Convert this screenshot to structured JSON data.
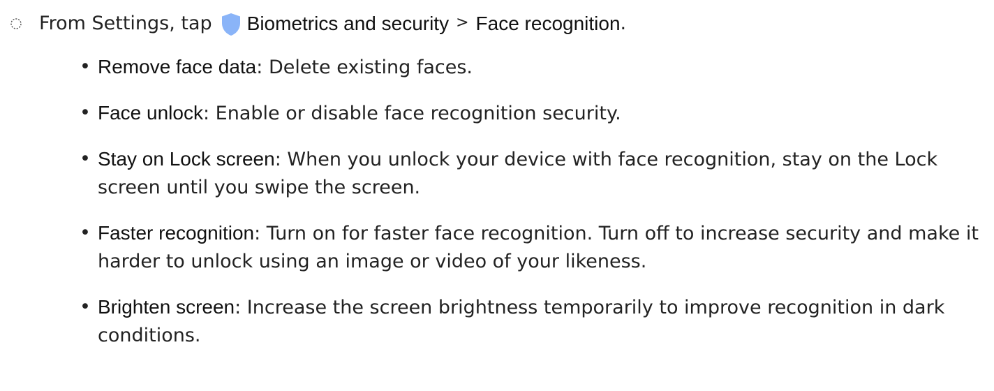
{
  "intro": {
    "prefix": "From Settings, tap",
    "icon": "shield-icon",
    "icon_color": "#8ab4f8",
    "menu_item": "Biometrics and security",
    "separator": ">",
    "submenu_item": "Face recognition",
    "suffix": "."
  },
  "options": [
    {
      "bullet": "•",
      "term": "Remove face data",
      "colon": ":",
      "description": " Delete existing faces."
    },
    {
      "bullet": "•",
      "term": "Face unlock",
      "colon": ":",
      "description": " Enable or disable face recognition security."
    },
    {
      "bullet": "•",
      "term": "Stay on Lock screen",
      "colon": ":",
      "description": " When you unlock your device with face recognition, stay on the Lock screen until you swipe the screen."
    },
    {
      "bullet": "•",
      "term": "Faster recognition",
      "colon": ":",
      "description": " Turn on for faster face recognition. Turn off to increase security and make it harder to unlock using an image or video of your likeness."
    },
    {
      "bullet": "•",
      "term": "Brighten screen",
      "colon": ":",
      "description": " Increase the screen brightness temporarily to improve recognition in dark conditions."
    }
  ]
}
